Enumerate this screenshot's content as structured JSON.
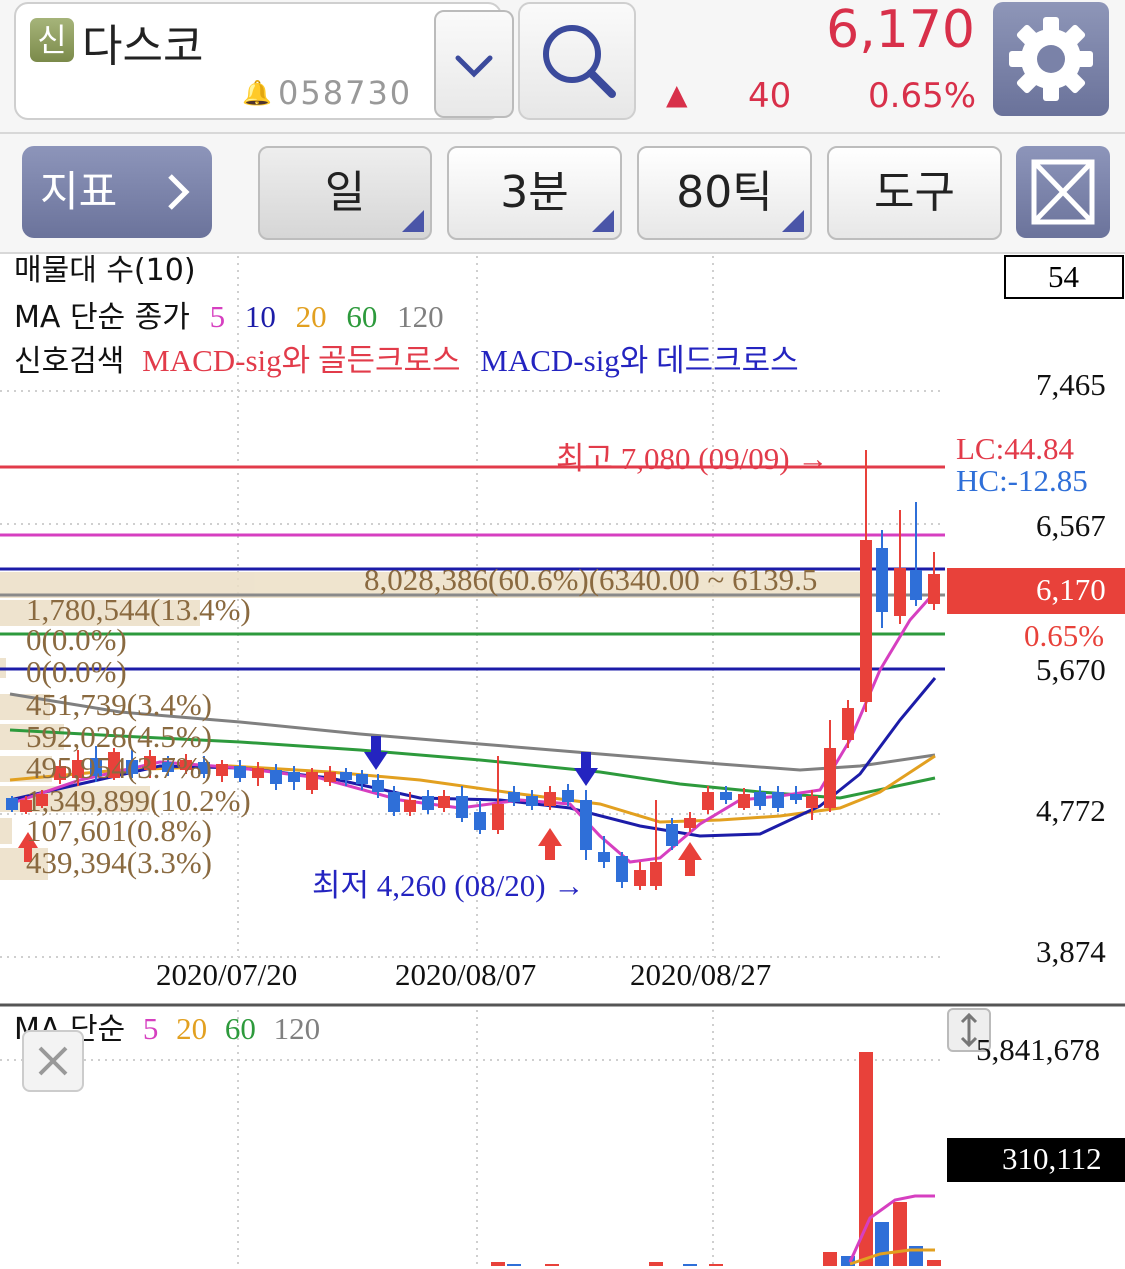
{
  "stock": {
    "badge": "신",
    "name": "다스코",
    "code": "058730",
    "price": "6,170",
    "change_arrow": "▲",
    "change": "40",
    "change_pct": "0.65%"
  },
  "toolbar": {
    "indicator_label": "지표",
    "period_day": "일",
    "period_min": "3분",
    "period_tick": "80틱",
    "tools": "도구"
  },
  "price_panel": {
    "legend_volume_profile": "매물대 수(10)",
    "legend_ma_prefix": "MA 단순 종가",
    "ma_periods": [
      "5",
      "10",
      "20",
      "60",
      "120"
    ],
    "signal_prefix": "신호검색",
    "signal_golden": "MACD-sig와 골든크로스",
    "signal_dead": "MACD-sig와 데드크로스",
    "count_box": "54",
    "axis_labels": [
      "7,465",
      "6,567",
      "5,670",
      "4,772",
      "3,874"
    ],
    "lc": "LC:44.84",
    "hc": "HC:-12.85",
    "current_price_tag": "6,170",
    "current_pct": "0.65%",
    "high_annotation": "최고 7,080 (09/09) →",
    "low_annotation": "최저 4,260 (08/20) →",
    "volume_profile_main": "8,028,386(60.6%)(6340.00 ~ 6139.5",
    "volume_profile_rows": [
      "1,780,544(13.4%)",
      "0(0.0%)",
      "0(0.0%)",
      "451,739(3.4%)",
      "592,028(4.5%)",
      "495,954(3.7%)",
      "1,349,899(10.2%)",
      "107,601(0.8%)",
      "439,394(3.3%)"
    ],
    "dates": [
      "2020/07/20",
      "2020/08/07",
      "2020/08/27"
    ]
  },
  "volume_panel": {
    "legend_prefix": "MA 단순",
    "ma_periods": [
      "5",
      "20",
      "60",
      "120"
    ],
    "max_label": "5,841,678",
    "current_tag": "310,112"
  },
  "colors": {
    "up": "#e8413a",
    "down": "#2f6fd8",
    "ma5": "#d63fc0",
    "ma10": "#1c1ca8",
    "ma20": "#e2a020",
    "ma60": "#2d9a3c",
    "ma120": "#808080"
  }
}
